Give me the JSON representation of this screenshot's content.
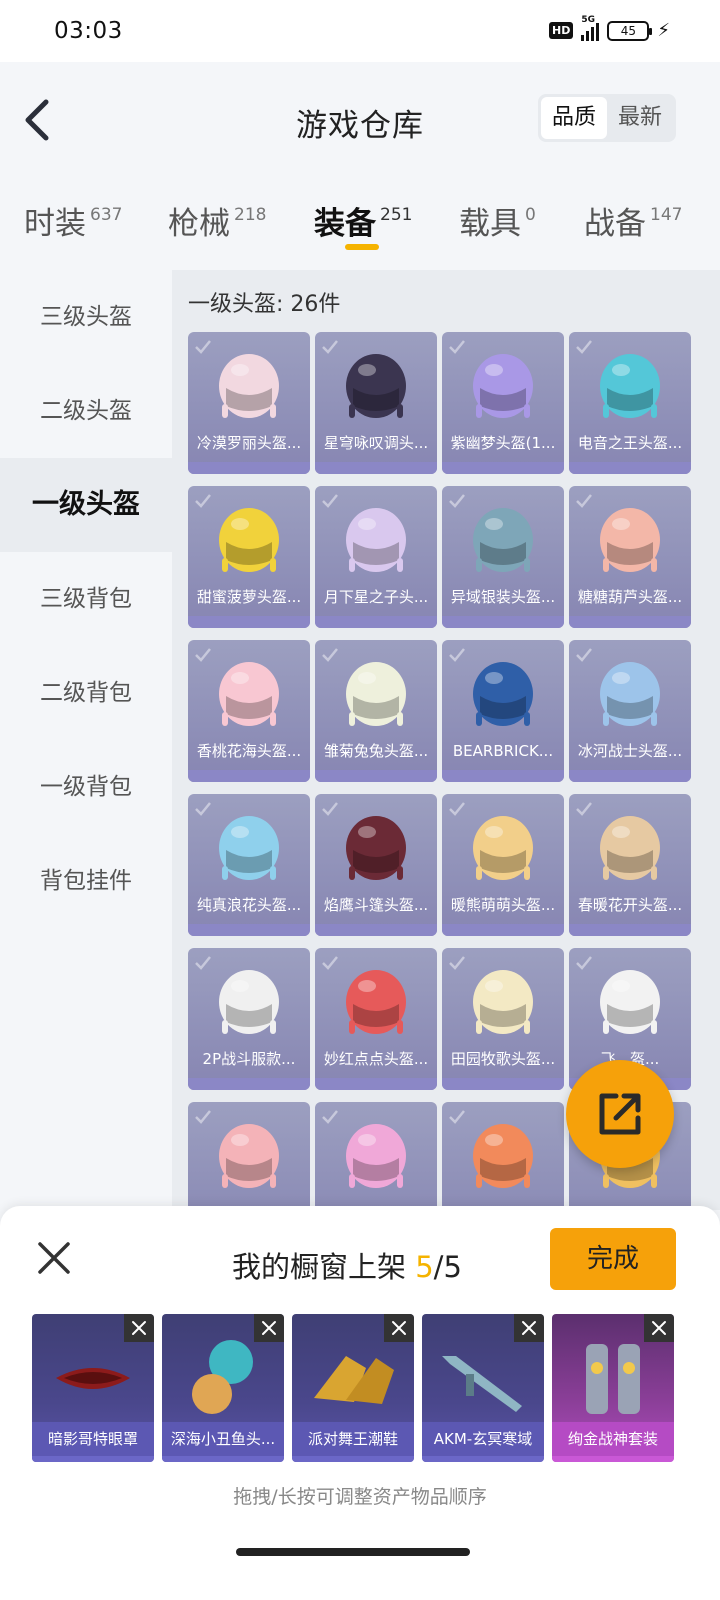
{
  "status_bar": {
    "time": "03:03",
    "hd": "HD",
    "network": "5G",
    "battery": "45"
  },
  "header": {
    "title": "游戏仓库",
    "sort": [
      "品质",
      "最新"
    ],
    "sort_selected": "品质"
  },
  "tabs": [
    {
      "label": "时装",
      "count": "637"
    },
    {
      "label": "枪械",
      "count": "218"
    },
    {
      "label": "装备",
      "count": "251",
      "active": true
    },
    {
      "label": "载具",
      "count": "0"
    },
    {
      "label": "战备",
      "count": "147"
    }
  ],
  "sidebar": [
    "三级头盔",
    "二级头盔",
    "一级头盔",
    "三级背包",
    "二级背包",
    "一级背包",
    "背包挂件"
  ],
  "sidebar_active": "一级头盔",
  "content": {
    "section_title": "一级头盔: 26件",
    "items": [
      {
        "name": "冷漠罗丽头盔...",
        "color": "#f2d8e0"
      },
      {
        "name": "星穹咏叹调头...",
        "color": "#3b3550"
      },
      {
        "name": "紫幽梦头盔(1...",
        "color": "#a998e6"
      },
      {
        "name": "电音之王头盔...",
        "color": "#54c7d8"
      },
      {
        "name": "甜蜜菠萝头盔...",
        "color": "#f1d23b"
      },
      {
        "name": "月下星之子头...",
        "color": "#d9c8ee"
      },
      {
        "name": "异域银装头盔...",
        "color": "#7ea6b8"
      },
      {
        "name": "糖糖葫芦头盔...",
        "color": "#f3b7a8"
      },
      {
        "name": "香桃花海头盔...",
        "color": "#f8c7d2"
      },
      {
        "name": "雏菊兔兔头盔...",
        "color": "#eef0dc"
      },
      {
        "name": "BEARBRICK...",
        "color": "#2f5fa8"
      },
      {
        "name": "冰河战士头盔...",
        "color": "#9dc4ea"
      },
      {
        "name": "纯真浪花头盔...",
        "color": "#8fd0ec"
      },
      {
        "name": "焰鹰斗篷头盔...",
        "color": "#6b2a36"
      },
      {
        "name": "暖熊萌萌头盔...",
        "color": "#f2cf8a"
      },
      {
        "name": "春暖花开头盔...",
        "color": "#e6c9a2"
      },
      {
        "name": "2P战斗服款...",
        "color": "#f0f0f0"
      },
      {
        "name": "妙红点点头盔...",
        "color": "#e65a5a"
      },
      {
        "name": "田园牧歌头盔...",
        "color": "#f3e9c4"
      },
      {
        "name": "飞...盔...",
        "color": "#f2f2f2"
      },
      {
        "name": "",
        "color": "#f4b3b8"
      },
      {
        "name": "",
        "color": "#f0a8d8"
      },
      {
        "name": "",
        "color": "#f28a5b"
      },
      {
        "name": "",
        "color": "#f0c060"
      }
    ]
  },
  "showcase": {
    "title_prefix": "我的橱窗上架 ",
    "count": "5",
    "total": "/5",
    "done_label": "完成",
    "items": [
      {
        "name": "暗影哥特眼罩",
        "tier": "purple"
      },
      {
        "name": "深海小丑鱼头...",
        "tier": "purple"
      },
      {
        "name": "派对舞王潮鞋",
        "tier": "purple"
      },
      {
        "name": "AKM-玄冥寒域",
        "tier": "purple"
      },
      {
        "name": "绚金战神套装",
        "tier": "gold"
      }
    ],
    "hint": "拖拽/长按可调整资产物品顺序"
  }
}
